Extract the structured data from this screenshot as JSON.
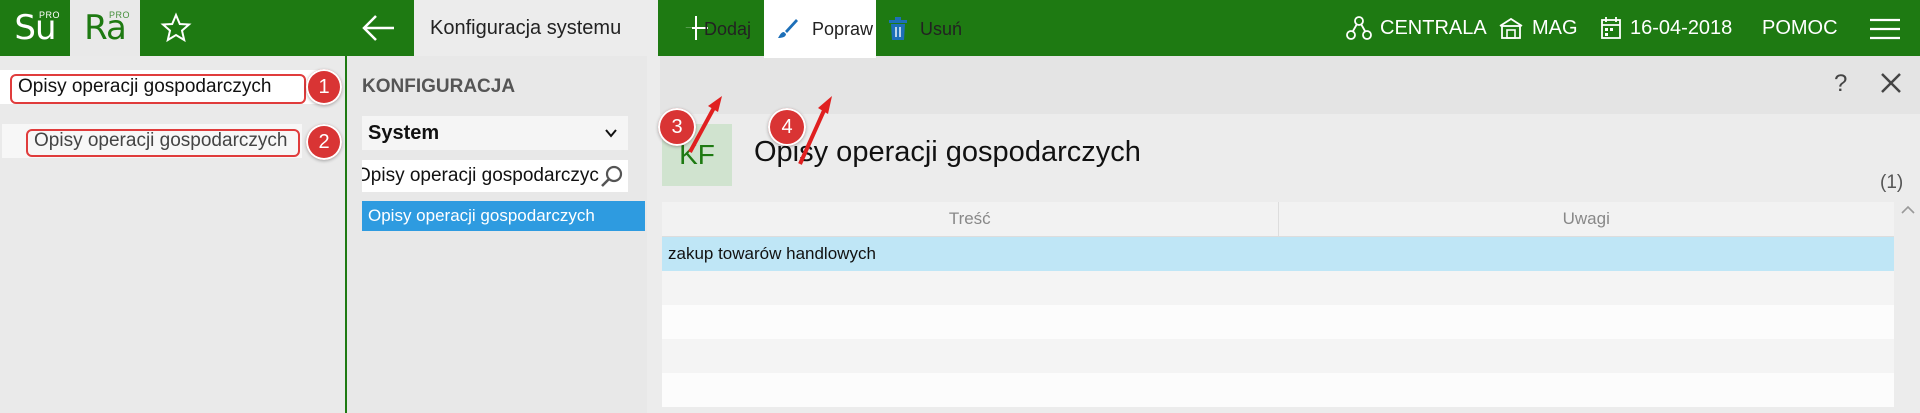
{
  "topbar": {
    "app1": {
      "main": "Su",
      "sup": "PRO"
    },
    "app2": {
      "main": "Ra",
      "sup": "PRO"
    },
    "active_tab": "Konfiguracja systemu",
    "centrala": "CENTRALA",
    "mag": "MAG",
    "date": "16-04-2018",
    "help": "POMOC"
  },
  "left": {
    "search_value": "Opisy operacji gospodarczych",
    "item": "Opisy operacji gospodarczych"
  },
  "middle": {
    "heading": "KONFIGURACJA",
    "select_value": "System",
    "search_value": "Opisy operacji gospodarczych",
    "item": "Opisy operacji gospodarczych"
  },
  "toolbar": {
    "add": "Dodaj",
    "edit": "Popraw",
    "delete": "Usuń",
    "help": "?"
  },
  "content": {
    "badge": "KF",
    "title": "Opisy operacji gospodarczych",
    "count": "(1)",
    "columns": [
      "Treść",
      "Uwagi"
    ],
    "rows": [
      "zakup towarów handlowych"
    ]
  },
  "markers": [
    "1",
    "2",
    "3",
    "4"
  ],
  "colors": {
    "brand": "#1e7a12",
    "selection": "#2e9be0",
    "annotation": "#d93434"
  }
}
